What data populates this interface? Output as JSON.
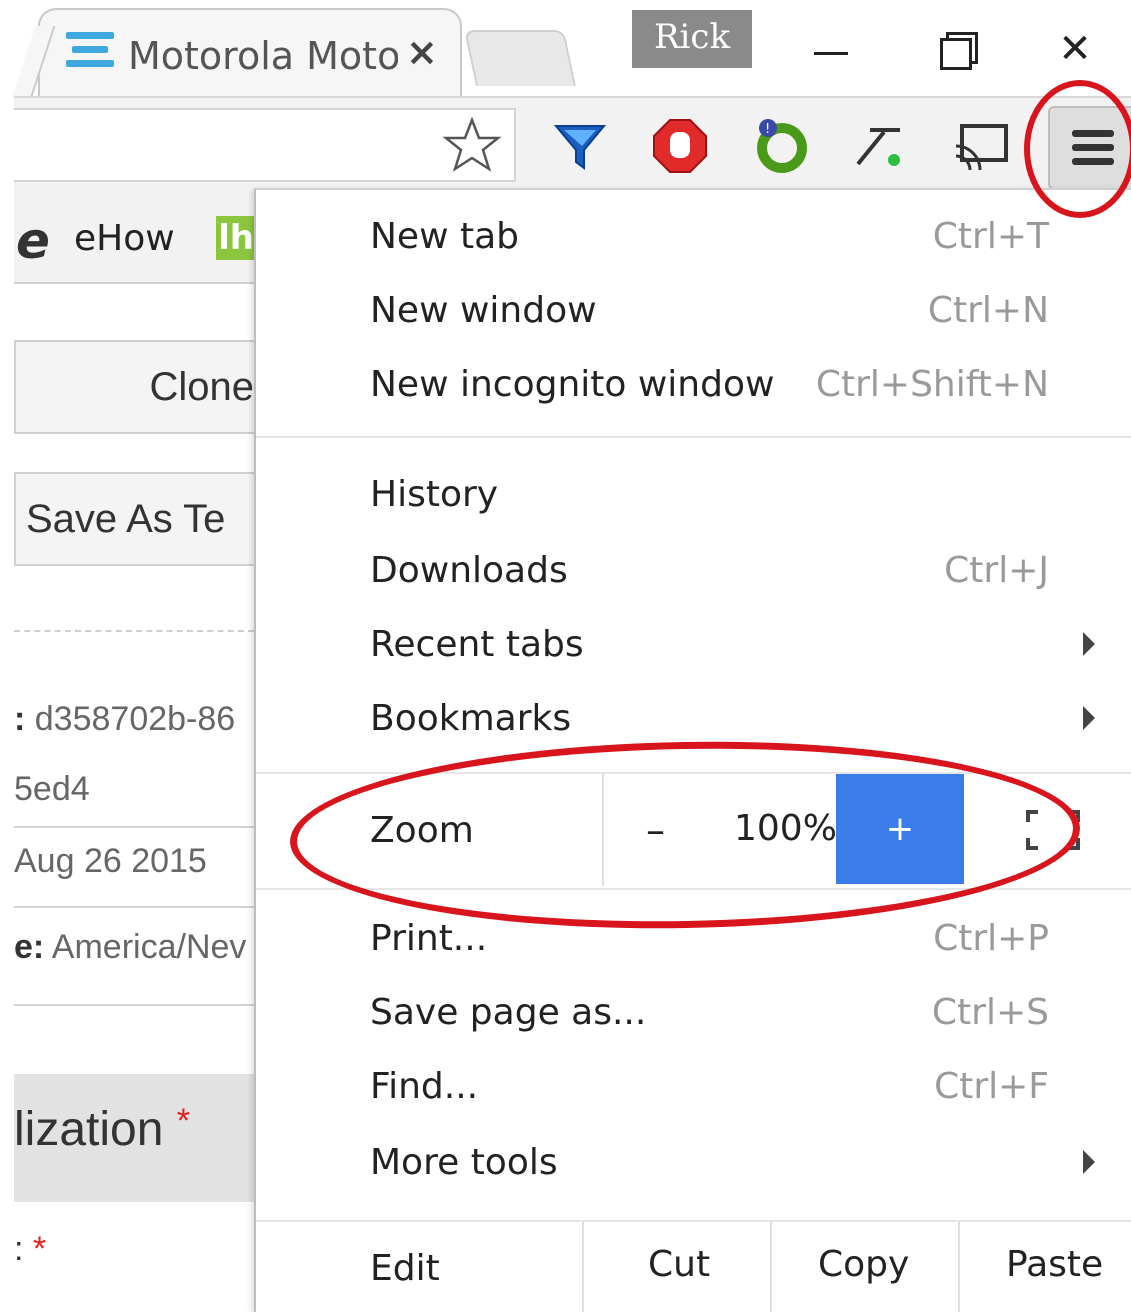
{
  "browser": {
    "tab": {
      "title": "Motorola Moto",
      "favicon": "list-icon",
      "close_glyph": "×"
    },
    "profile": "Rick",
    "window_controls": {
      "minimize": "minimize-icon",
      "maximize": "restore-icon",
      "close": "✕"
    }
  },
  "toolbar": {
    "icons": [
      "star-icon",
      "filter-icon",
      "stop-hand-icon",
      "extension-icon",
      "tools-icon",
      "cast-icon",
      "menu-icon"
    ]
  },
  "page": {
    "bookmarks": {
      "ehow_icon": "e",
      "ehow": "eHow",
      "other_icon": "lh"
    },
    "clone_btn": "Clone",
    "save_template_btn": "Save As Te",
    "id_prefix": ":",
    "id_value": " d358702b-86",
    "id_cont": "5ed4",
    "date": "Aug 26 2015",
    "tz_prefix": "e:",
    "tz_value": " America/Nev",
    "section": "lization",
    "field": ":",
    "req_mark": "*"
  },
  "menu": {
    "items_top": [
      {
        "label": "New tab",
        "shortcut": "Ctrl+T"
      },
      {
        "label": "New window",
        "shortcut": "Ctrl+N"
      },
      {
        "label": "New incognito window",
        "shortcut": "Ctrl+Shift+N"
      }
    ],
    "items_mid": [
      {
        "label": "History",
        "shortcut": ""
      },
      {
        "label": "Downloads",
        "shortcut": "Ctrl+J"
      },
      {
        "label": "Recent tabs",
        "shortcut": ""
      },
      {
        "label": "Bookmarks",
        "shortcut": ""
      }
    ],
    "zoom": {
      "label": "Zoom",
      "minus": "–",
      "value": "100%",
      "plus": "+"
    },
    "items_bottom": [
      {
        "label": "Print...",
        "shortcut": "Ctrl+P"
      },
      {
        "label": "Save page as...",
        "shortcut": "Ctrl+S"
      },
      {
        "label": "Find...",
        "shortcut": "Ctrl+F"
      },
      {
        "label": "More tools",
        "shortcut": ""
      }
    ],
    "edit": {
      "label": "Edit",
      "cut": "Cut",
      "copy": "Copy",
      "paste": "Paste"
    }
  },
  "colors": {
    "annotation": "#d8141c",
    "zoom_accent": "#3b7de8",
    "required": "#e02020"
  }
}
